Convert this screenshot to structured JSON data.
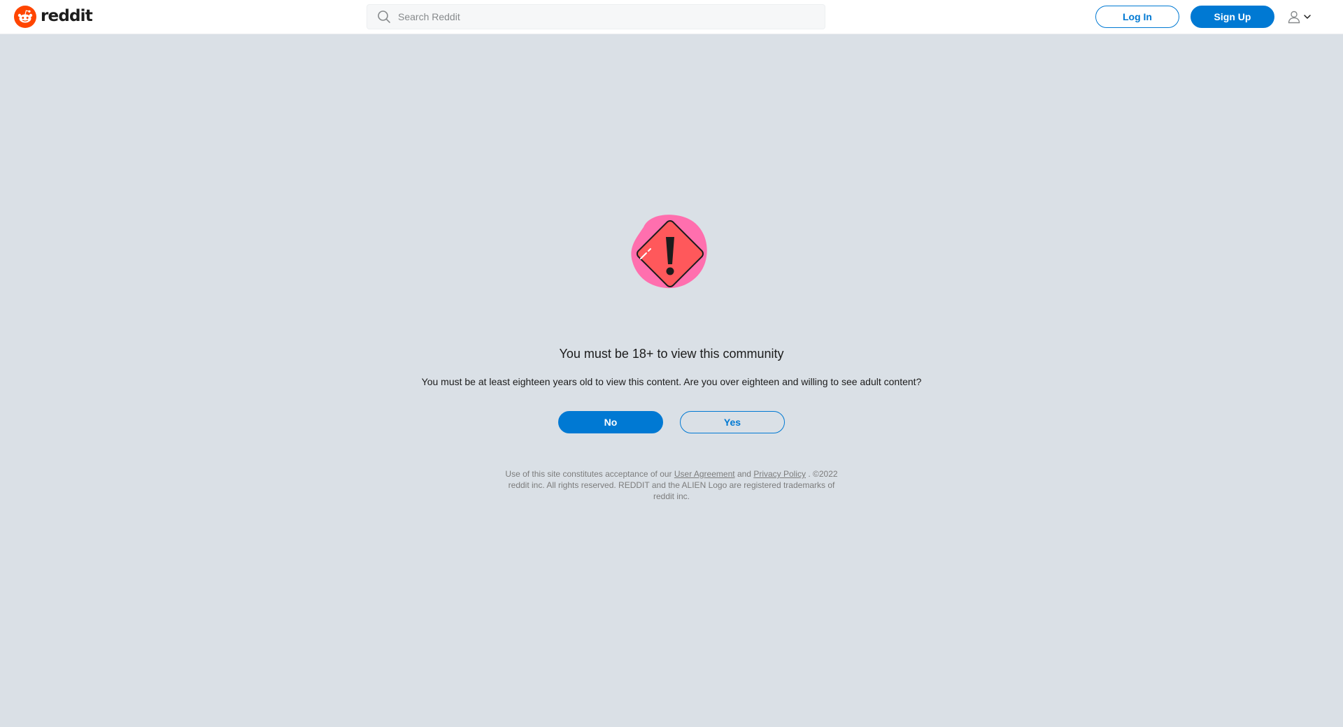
{
  "header": {
    "logo_text": "reddit",
    "search": {
      "placeholder": "Search Reddit",
      "value": ""
    },
    "login_label": "Log In",
    "signup_label": "Sign Up"
  },
  "icons": {
    "logo": "reddit-alien-logo-icon",
    "search": "search-icon",
    "user": "user-icon",
    "menu_chevron": "chevron-down-icon",
    "warning": "warning-sign-icon"
  },
  "colors": {
    "brand_orange": "#ff4500",
    "primary_blue": "#0079d3",
    "page_bg": "#dae0e6",
    "warning_red": "#ff585b",
    "warning_blob": "#ff6fae"
  },
  "gate": {
    "title": "You must be 18+ to view this community",
    "description": "You must be at least eighteen years old to view this content. Are you over eighteen and willing to see adult content?",
    "no_label": "No",
    "yes_label": "Yes"
  },
  "legal": {
    "prefix": "Use of this site constitutes acceptance of our",
    "user_agreement": "User Agreement",
    "and": "and",
    "privacy_policy": "Privacy Policy",
    "period": ".",
    "copyright": "©2022 reddit inc. All rights reserved. REDDIT and the ALIEN Logo are registered trademarks of reddit inc."
  }
}
